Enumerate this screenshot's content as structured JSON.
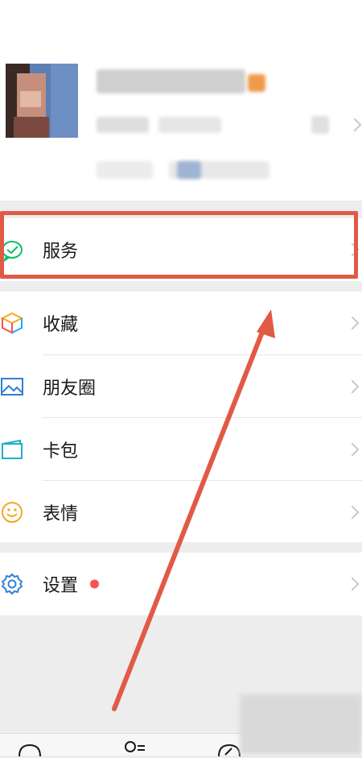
{
  "profile": {
    "avatar_icon": "user-avatar",
    "chevron_icon": "chevron-right-icon"
  },
  "menu": {
    "services": {
      "label": "服务",
      "icon": "wechat-pay-icon"
    },
    "favorites": {
      "label": "收藏",
      "icon": "cube-icon"
    },
    "moments": {
      "label": "朋友圈",
      "icon": "image-icon"
    },
    "cards": {
      "label": "卡包",
      "icon": "wallet-icon"
    },
    "stickers": {
      "label": "表情",
      "icon": "smiley-icon"
    },
    "settings": {
      "label": "设置",
      "icon": "gear-icon",
      "has_badge": true
    }
  },
  "colors": {
    "highlight": "#e05a47",
    "badge": "#fa5151",
    "green": "#07c160"
  }
}
